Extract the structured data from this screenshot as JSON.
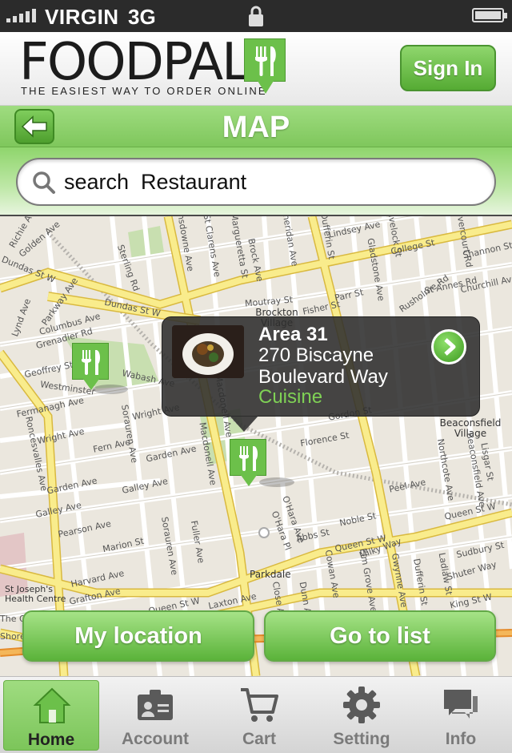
{
  "status_bar": {
    "carrier": "VIRGIN",
    "network": "3G",
    "icons": [
      "signal-bars-icon",
      "lock-icon",
      "battery-icon"
    ]
  },
  "header": {
    "logo_text": "FOODPAL",
    "tagline": "THE EASIEST WAY TO ORDER ONLINE",
    "sign_in_label": "Sign In"
  },
  "title_bar": {
    "title": "MAP",
    "back_icon": "back-arrow-icon"
  },
  "search": {
    "placeholder": "search  Restaurant",
    "value": ""
  },
  "map": {
    "streets": [
      "Richie Av",
      "Golden Ave",
      "Dundas St W",
      "Sterling Rd",
      "Lansdowne Ave",
      "St Clarens Ave",
      "Margueretta St",
      "Brock Ave",
      "Sheridan Ave",
      "Dufferin St",
      "Lindsey Ave",
      "Havelock St",
      "Dovercourt Rd",
      "Shannon St",
      "College St",
      "Parkway Ave",
      "Columbus Ave",
      "Grenadier Rd",
      "Lynd Ave",
      "Dundas St W",
      "Moutray St",
      "Brockton Village",
      "Fisher St",
      "Parr St",
      "Gladstone Ave",
      "Rusholme Rd",
      "St Annes Rd",
      "Churchill Ave",
      "Geoffrey St",
      "Westminster",
      "Wabash Ave",
      "Fermanagh Ave",
      "Wright Ave",
      "Wright Ave",
      "Fern Ave",
      "Garden Ave",
      "Florence St",
      "Gordon St",
      "Beaconsfield Village",
      "Beaconsfield Ave",
      "Lisgar St",
      "Galley Ave",
      "Garden Ave",
      "Galley Ave",
      "Sorauren Ave",
      "Macdonell Ave",
      "Northcote Ave",
      "Peel Ave",
      "Queen St W",
      "Pearson Ave",
      "Marion St",
      "Harvard Ave",
      "Grafton Ave",
      "Fuller Ave",
      "O'Hara Ave",
      "O'Hara Pl",
      "Noble St",
      "Abbs St",
      "Milky Way",
      "Queen St W",
      "Sudbury St",
      "Shuter Way",
      "Parkdale",
      "Laxton Ave",
      "Queen St W",
      "Cowan Ave",
      "Elm Grove Ave",
      "Gwynne Ave",
      "Dufferin St",
      "King St W",
      "Ladlaw St",
      "St Joseph's Health Centre",
      "Roncesvalles Ave",
      "Macdonell Ave",
      "Sorauren Ave",
      "Dunn Ave",
      "Close Ave",
      "The Queensway",
      "Shore",
      "Noble St",
      "Beaconsfield Ave",
      "Grove Ave",
      "Skey Ln",
      "Lisgar St"
    ],
    "popup": {
      "name": "Area 31",
      "address": "270 Biscayne Boulevard Way",
      "cuisine": "Cuisine",
      "go_icon": "chevron-right-circle-icon"
    },
    "pins": [
      "restaurant-pin-icon",
      "restaurant-pin-icon"
    ],
    "my_location_label": "My location",
    "go_to_list_label": "Go to list"
  },
  "tabs": [
    {
      "label": "Home",
      "icon": "home-icon",
      "active": true
    },
    {
      "label": "Account",
      "icon": "account-card-icon",
      "active": false
    },
    {
      "label": "Cart",
      "icon": "cart-icon",
      "active": false
    },
    {
      "label": "Setting",
      "icon": "gear-icon",
      "active": false
    },
    {
      "label": "Info",
      "icon": "speech-bubble-icon",
      "active": false
    }
  ],
  "colors": {
    "accent_green": "#6cc04a",
    "status_bar_bg": "#2b2b2b",
    "popup_cuisine": "#7fd155"
  }
}
